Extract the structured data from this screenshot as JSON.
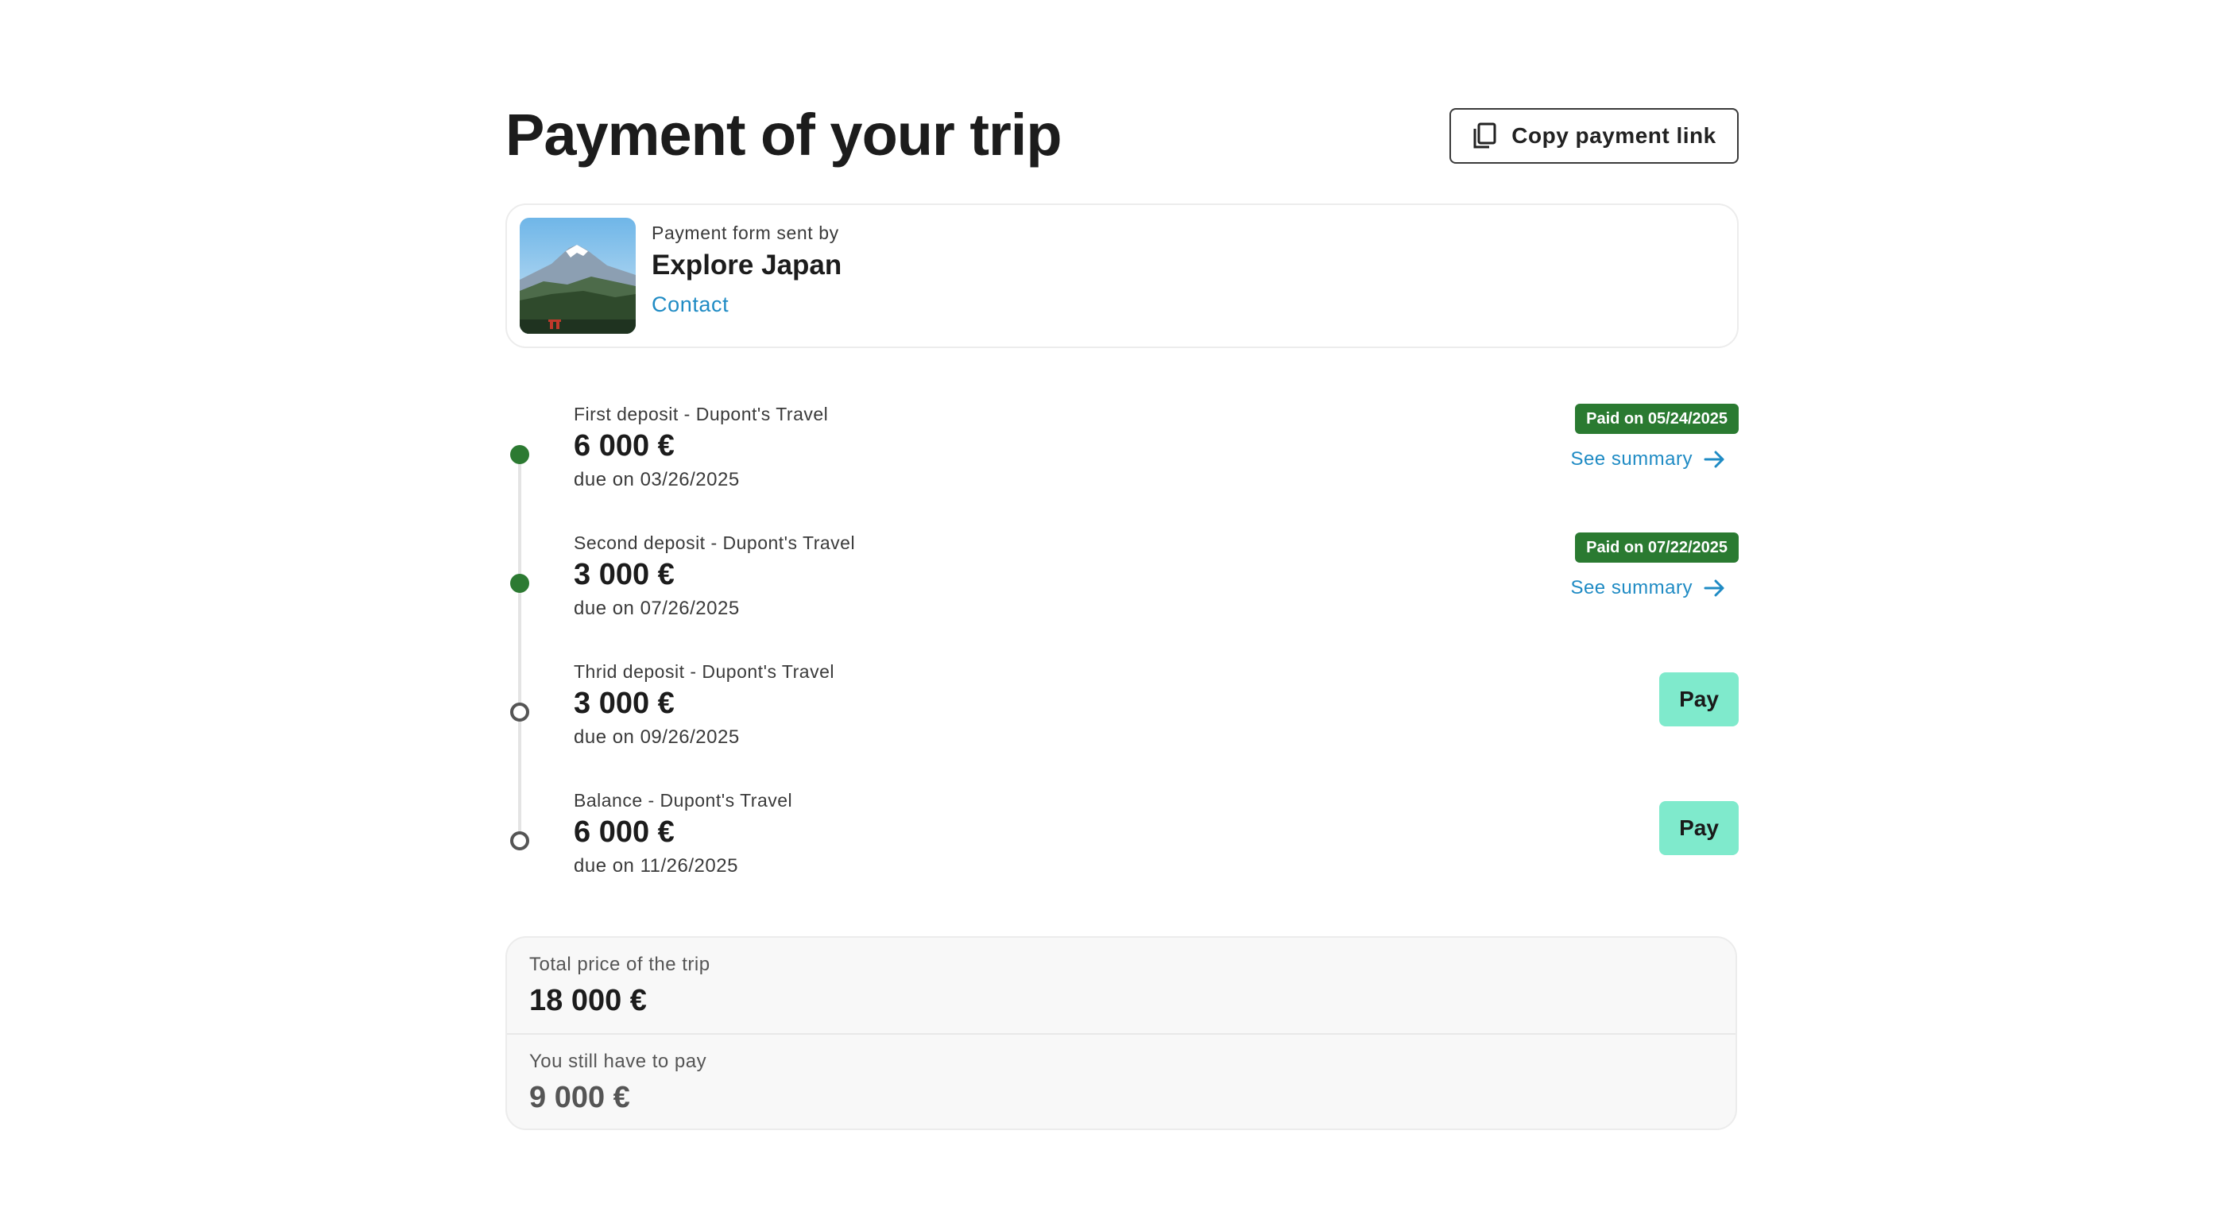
{
  "header": {
    "title": "Payment of your trip",
    "copy_button": {
      "label": "Copy payment link",
      "icon": "copy-icon"
    }
  },
  "agency": {
    "sent_by_label": "Payment form sent by",
    "name": "Explore Japan",
    "contact_label": "Contact",
    "image": "mount-fuji-landscape"
  },
  "payments": [
    {
      "label": "First deposit - Dupont's Travel",
      "amount": "6 000 €",
      "due": "due on 03/26/2025",
      "status": "paid",
      "paid_label": "Paid on 05/24/2025",
      "summary_label": "See summary"
    },
    {
      "label": "Second deposit - Dupont's Travel",
      "amount": "3 000 €",
      "due": "due on 07/26/2025",
      "status": "paid",
      "paid_label": "Paid on 07/22/2025",
      "summary_label": "See summary"
    },
    {
      "label": "Thrid deposit - Dupont's Travel",
      "amount": "3 000 €",
      "due": "due on 09/26/2025",
      "status": "pending",
      "pay_label": "Pay"
    },
    {
      "label": "Balance - Dupont's Travel",
      "amount": "6 000 €",
      "due": "due on 11/26/2025",
      "status": "pending",
      "pay_label": "Pay"
    }
  ],
  "totals": {
    "total_label": "Total price of the trip",
    "total_value": "18 000 €",
    "remaining_label": "You still have to pay",
    "remaining_value": "9 000 €"
  },
  "colors": {
    "paid_green": "#2a7a31",
    "link_blue": "#1f8bc4",
    "pay_button": "#7feacc"
  }
}
